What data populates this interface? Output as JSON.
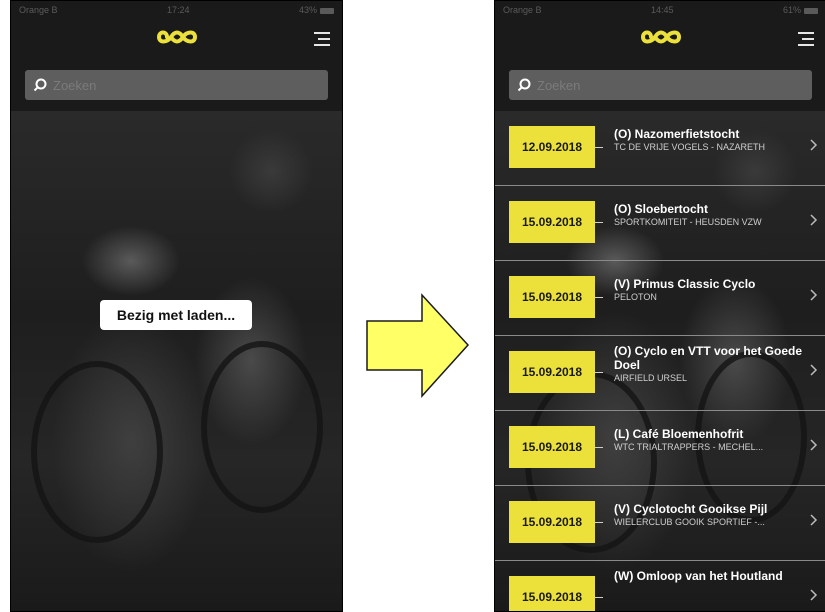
{
  "colors": {
    "accent": "#ece13a",
    "arrow": "#ffff66"
  },
  "left_screen": {
    "status": {
      "carrier": "Orange B",
      "time": "17:24",
      "battery": "43%"
    },
    "search": {
      "placeholder": "Zoeken"
    },
    "loading_text": "Bezig met laden..."
  },
  "right_screen": {
    "status": {
      "carrier": "Orange B",
      "time": "14:45",
      "battery": "61%"
    },
    "search": {
      "placeholder": "Zoeken"
    },
    "events": [
      {
        "date": "12.09.2018",
        "title": "(O) Nazomerfietstocht",
        "organizer": "TC DE VRIJE VOGELS - NAZARETH"
      },
      {
        "date": "15.09.2018",
        "title": "(O) Sloebertocht",
        "organizer": "SPORTKOMITEIT - HEUSDEN VZW"
      },
      {
        "date": "15.09.2018",
        "title": "(V) Primus Classic Cyclo",
        "organizer": "PELOTON"
      },
      {
        "date": "15.09.2018",
        "title": "(O) Cyclo en VTT voor het Goede Doel",
        "organizer": "AIRFIELD URSEL"
      },
      {
        "date": "15.09.2018",
        "title": "(L) Café Bloemenhofrit",
        "organizer": "WTC TRIALTRAPPERS - MECHEL..."
      },
      {
        "date": "15.09.2018",
        "title": "(V) Cyclotocht Gooikse Pijl",
        "organizer": "WIELERCLUB GOOIK SPORTIEF -..."
      },
      {
        "date": "15.09.2018",
        "title": "(W) Omloop van het Houtland",
        "organizer": ""
      }
    ]
  }
}
